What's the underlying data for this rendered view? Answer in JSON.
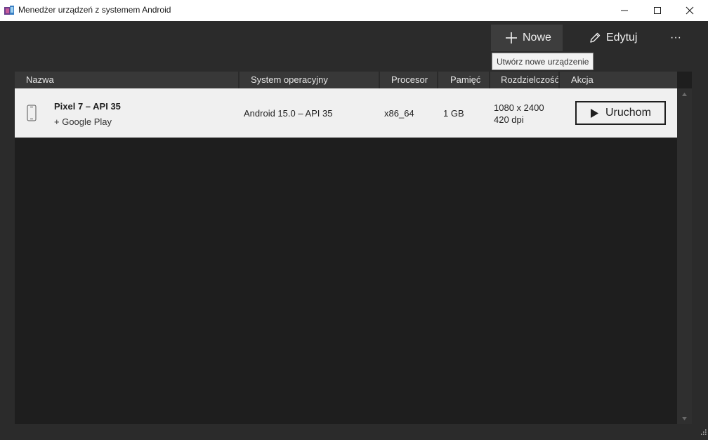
{
  "window": {
    "title": "Menedżer urządzeń z systemem Android"
  },
  "toolbar": {
    "new_label": "Nowe",
    "edit_label": "Edytuj",
    "more_label": "···",
    "tooltip": "Utwórz nowe urządzenie"
  },
  "table": {
    "headers": {
      "name": "Nazwa",
      "os": "System operacyjny",
      "cpu": "Procesor",
      "memory": "Pamięć",
      "resolution": "Rozdzielczość",
      "action": "Akcja"
    },
    "rows": [
      {
        "name": "Pixel 7 – API 35",
        "subtitle": "+ Google Play",
        "os": "Android 15.0 – API 35",
        "cpu": "x86_64",
        "memory": "1 GB",
        "resolution": "1080 x 2400",
        "density": "420 dpi",
        "action_label": "Uruchom"
      }
    ]
  },
  "colors": {
    "background": "#2b2b2b",
    "table_bg": "#1e1e1e",
    "header_bg": "#383838",
    "row_bg": "#f0f0f0",
    "accent_button": "#3d3d3d"
  },
  "icons": {
    "app": "android-device-manager-icon",
    "new": "plus-icon",
    "edit": "pencil-icon",
    "device": "phone-icon",
    "run": "play-icon"
  }
}
